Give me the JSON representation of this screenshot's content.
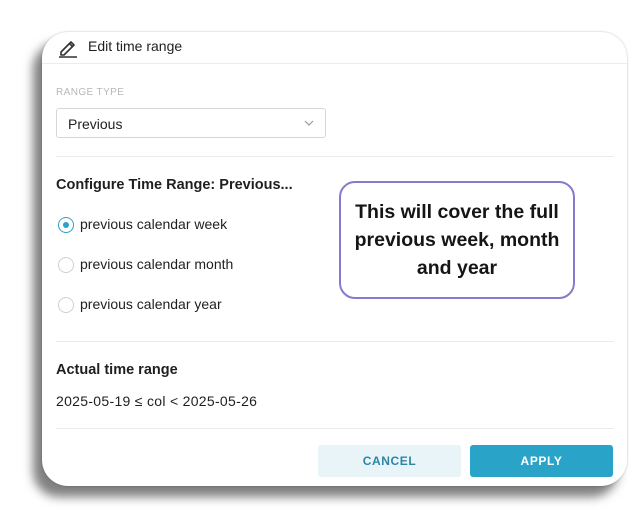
{
  "header": {
    "title": "Edit time range",
    "icon": "pencil-icon"
  },
  "range_type": {
    "label": "RANGE TYPE",
    "selected": "Previous",
    "icon": "chevron-down-icon"
  },
  "configure": {
    "title": "Configure Time Range: Previous...",
    "options": [
      {
        "label": "previous calendar week",
        "checked": true
      },
      {
        "label": "previous calendar month",
        "checked": false
      },
      {
        "label": "previous calendar year",
        "checked": false
      }
    ]
  },
  "callout": {
    "text": "This will cover the full previous week, month and year",
    "border_color": "#8a78cf"
  },
  "actual": {
    "title": "Actual time range",
    "value": "2025-05-19 ≤ col < 2025-05-26"
  },
  "footer": {
    "cancel_label": "CANCEL",
    "apply_label": "APPLY"
  },
  "colors": {
    "accent": "#2aa3c8",
    "accent_light": "#e8f4f8"
  }
}
